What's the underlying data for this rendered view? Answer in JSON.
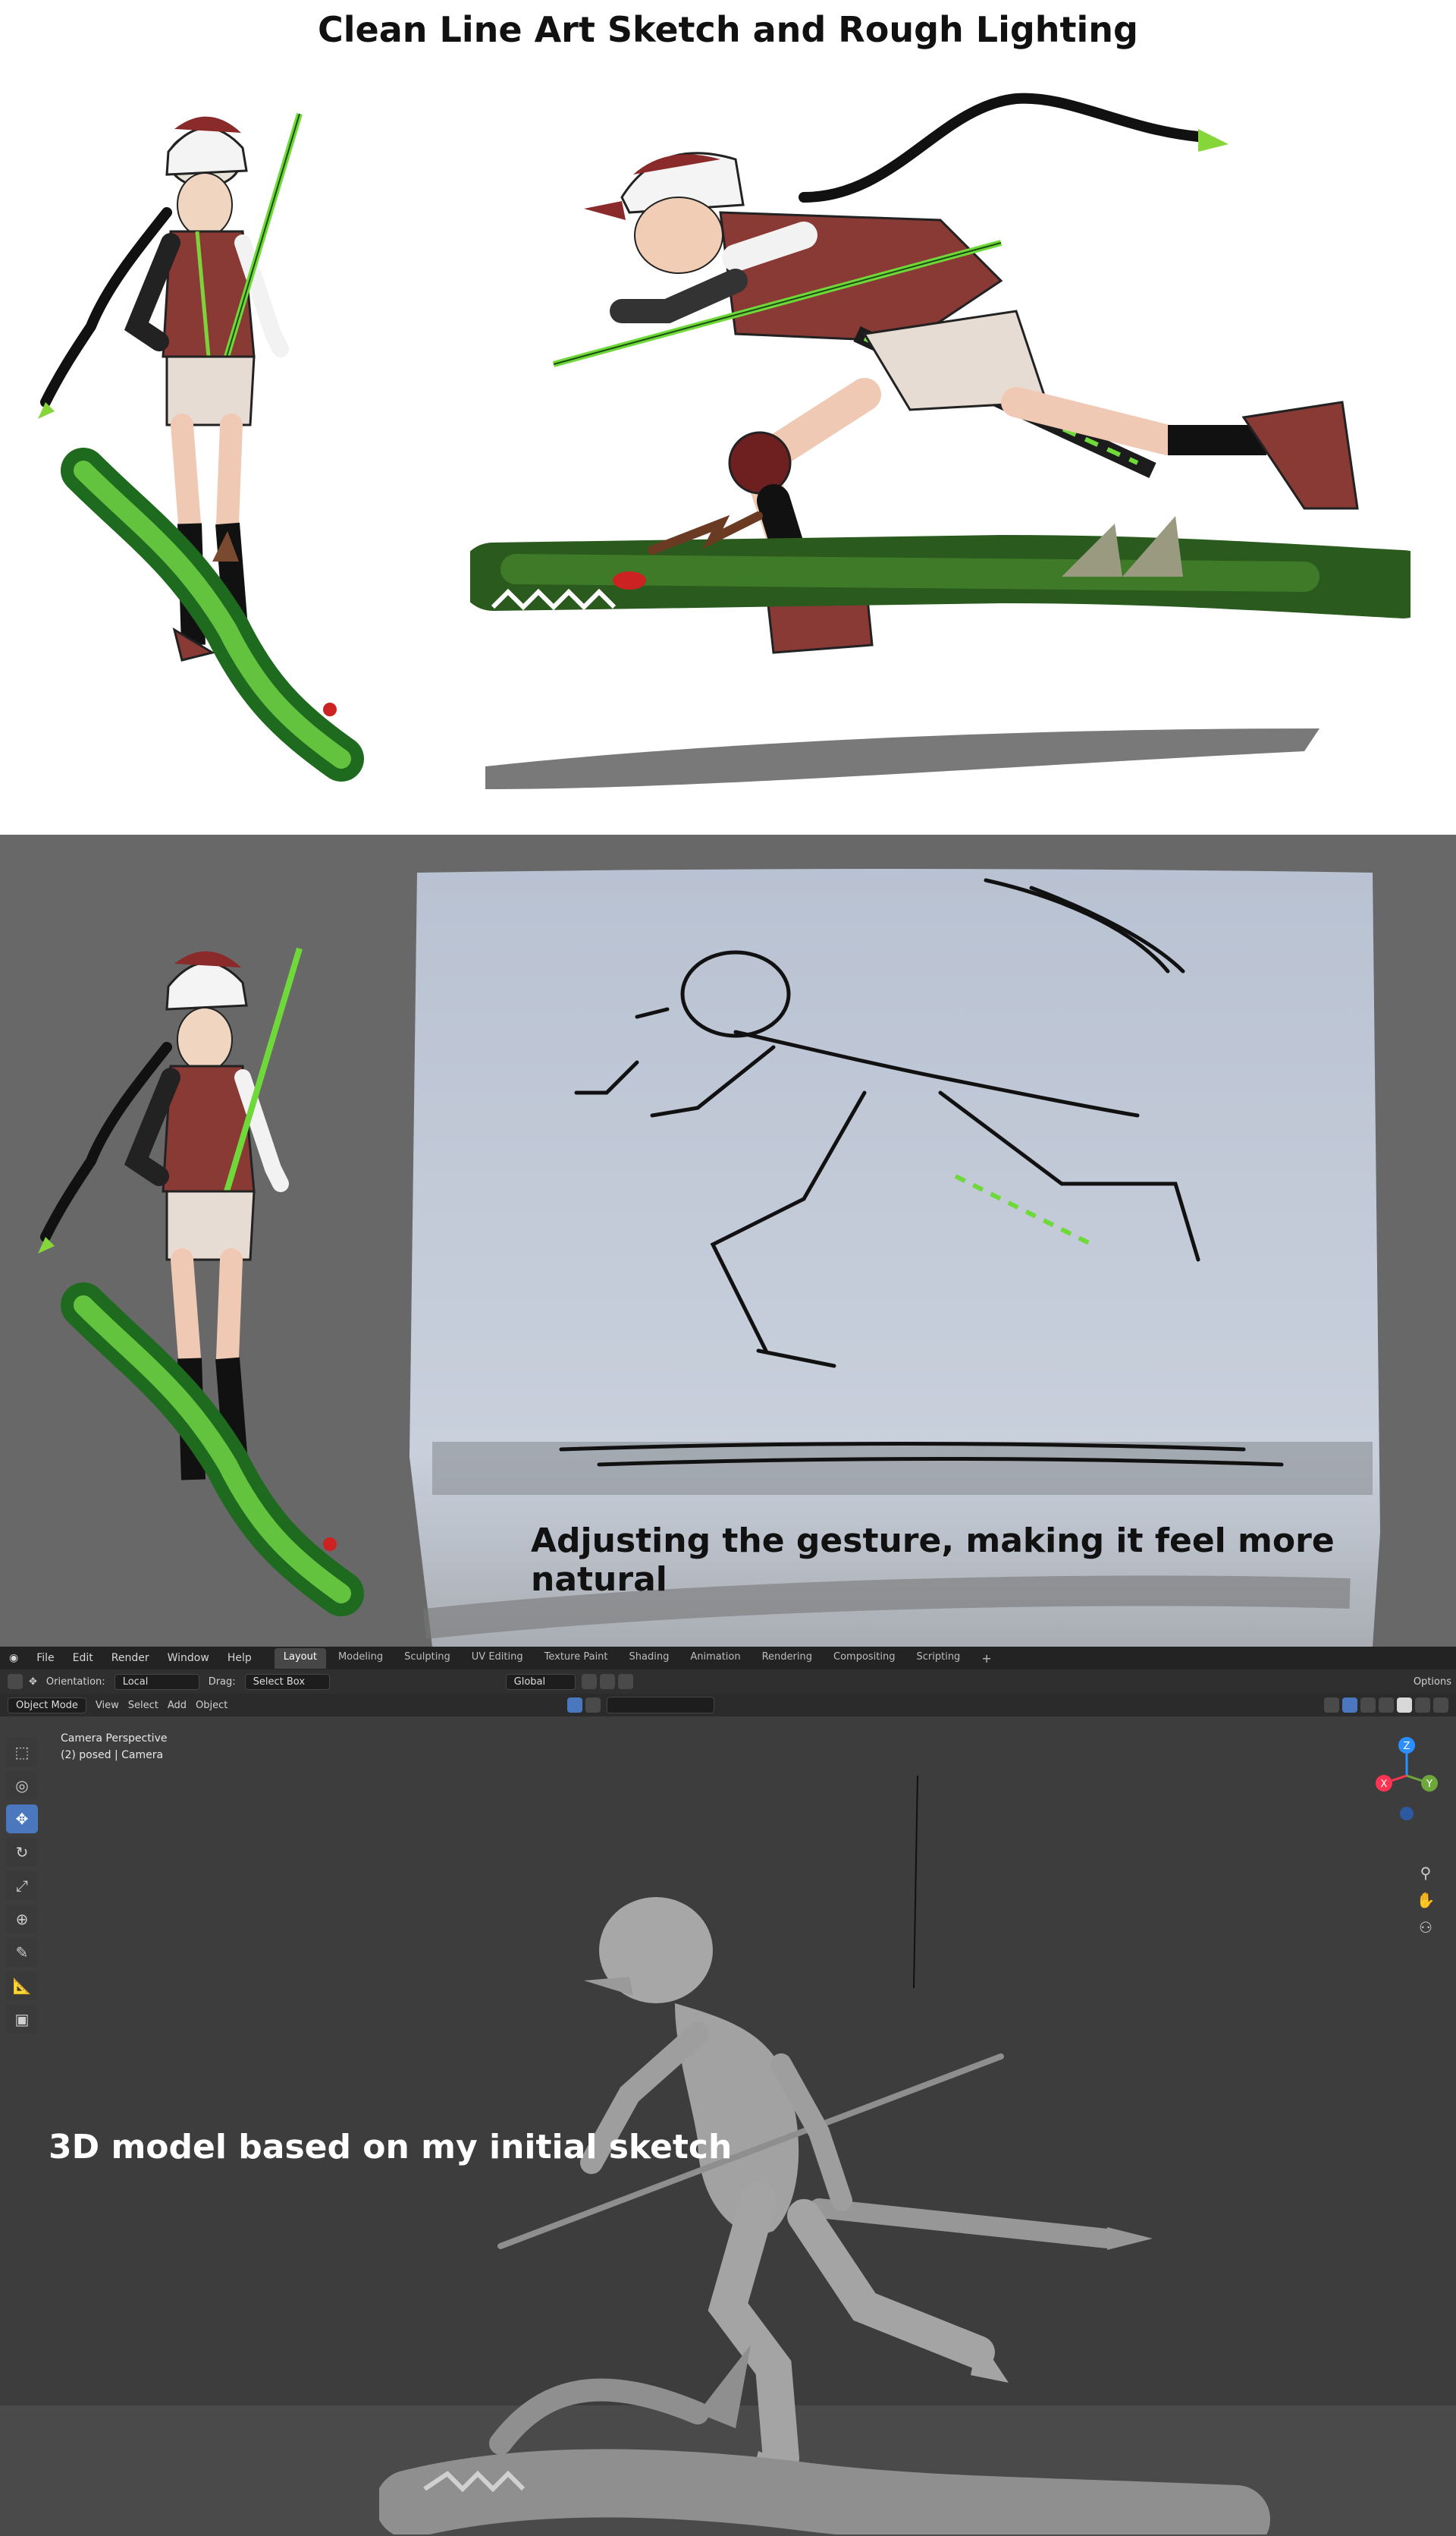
{
  "panel1": {
    "title": "Clean Line Art Sketch and Rough Lighting"
  },
  "panel2": {
    "caption": "Adjusting the gesture, making it feel more natural"
  },
  "panel3": {
    "caption": "3D model based on my initial sketch",
    "menu": [
      "File",
      "Edit",
      "Render",
      "Window",
      "Help"
    ],
    "workspace_tabs": [
      "Layout",
      "Modeling",
      "Sculpting",
      "UV Editing",
      "Texture Paint",
      "Shading",
      "Animation",
      "Rendering",
      "Compositing",
      "Scripting"
    ],
    "active_tab": "Layout",
    "header": {
      "orientation_label": "Orientation:",
      "orientation_value": "Local",
      "drag_label": "Drag:",
      "drag_value": "Select Box",
      "transform_orientation": "Global",
      "options": "Options"
    },
    "viewport_header": {
      "mode": "Object Mode",
      "menus": [
        "View",
        "Select",
        "Add",
        "Object"
      ]
    },
    "view_info": {
      "line1": "Camera Perspective",
      "line2": "(2) posed | Camera"
    },
    "gizmo_axes": {
      "z": "Z",
      "y": "Y",
      "x": "X",
      "z_color": "#2c8fff",
      "y_color": "#6ea83a",
      "x_color": "#ff3352"
    },
    "tools": [
      "select-box-icon",
      "cursor-icon",
      "move-icon",
      "rotate-icon",
      "scale-icon",
      "transform-icon",
      "annotate-icon",
      "measure-icon",
      "add-cube-icon"
    ]
  }
}
